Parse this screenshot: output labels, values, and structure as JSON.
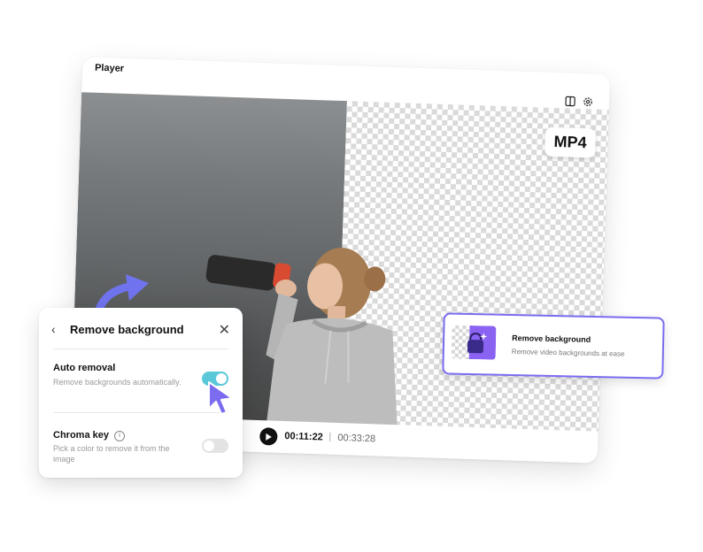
{
  "player": {
    "title": "Player",
    "format_badge": "MP4",
    "time_current": "00:11:22",
    "time_separator": "|",
    "time_total": "00:33:28",
    "icons": [
      "split-view-icon",
      "gear-icon",
      "play-icon"
    ]
  },
  "panel": {
    "title": "Remove background",
    "auto_removal": {
      "title": "Auto removal",
      "description": "Remove backgrounds automatically.",
      "enabled": true
    },
    "chroma_key": {
      "title": "Chroma key",
      "description": "Pick a color to remove it from the image",
      "enabled": false
    },
    "icons": [
      "chevron-left-icon",
      "close-icon",
      "info-icon"
    ]
  },
  "feature_card": {
    "title": "Remove background",
    "description": "Remove video backgrounds at ease"
  },
  "colors": {
    "accent_purple": "#7b6cf0",
    "toggle_on": "#5ac8d8",
    "arrow_blue": "#6f73ee"
  }
}
